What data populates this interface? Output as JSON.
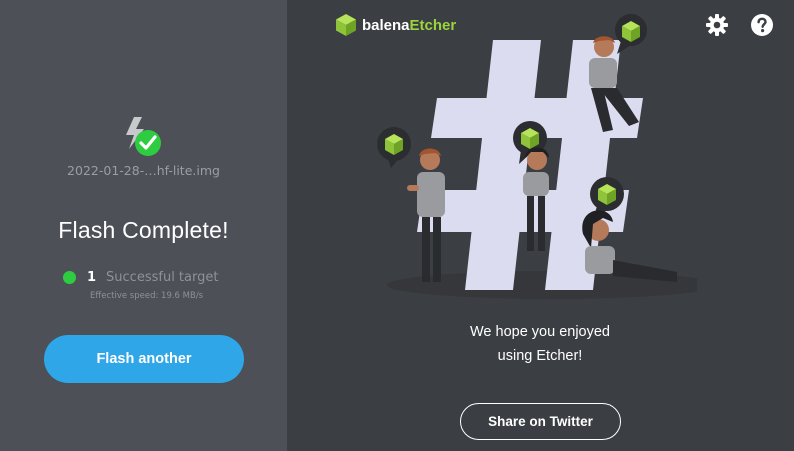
{
  "app": {
    "brand_prefix": "balena",
    "brand_suffix": "Etcher",
    "accent_color": "#2fa6e8",
    "brand_color": "#9bd43b",
    "success_color": "#2ecc40"
  },
  "left_panel": {
    "file_name": "2022-01-28-…hf-lite.img",
    "status_title": "Flash Complete!",
    "target_count": "1",
    "target_label": "Successful target",
    "speed_text": "Effective speed: 19.6 MB/s",
    "flash_another_label": "Flash another",
    "icon": "flash-complete-icon"
  },
  "right_panel": {
    "thanks_line1": "We hope you enjoyed",
    "thanks_line2": "using Etcher!",
    "share_label": "Share on Twitter",
    "icons": [
      "settings-gear-icon",
      "help-icon",
      "balena-cube-logo-icon"
    ]
  }
}
